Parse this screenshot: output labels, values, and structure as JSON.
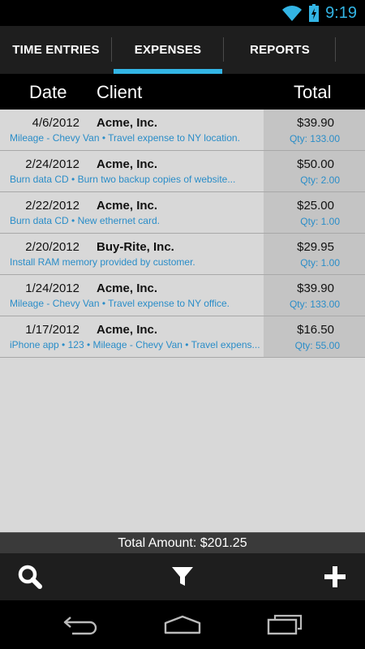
{
  "status_bar": {
    "time": "9:19",
    "wifi_icon": "wifi-icon",
    "battery_icon": "battery-charging-icon",
    "accent": "#33b5e5"
  },
  "tabs": [
    {
      "label": "TIME ENTRIES",
      "active": false
    },
    {
      "label": "EXPENSES",
      "active": true
    },
    {
      "label": "REPORTS",
      "active": false
    }
  ],
  "columns": {
    "date": "Date",
    "client": "Client",
    "total": "Total"
  },
  "expenses": [
    {
      "date": "4/6/2012",
      "client": "Acme, Inc.",
      "description": "Mileage - Chevy Van • Travel expense to NY location.",
      "total": "$39.90",
      "qty": "Qty: 133.00"
    },
    {
      "date": "2/24/2012",
      "client": "Acme, Inc.",
      "description": "Burn data CD • Burn two backup copies of website...",
      "total": "$50.00",
      "qty": "Qty: 2.00"
    },
    {
      "date": "2/22/2012",
      "client": "Acme, Inc.",
      "description": "Burn data CD • New ethernet card.",
      "total": "$25.00",
      "qty": "Qty: 1.00"
    },
    {
      "date": "2/20/2012",
      "client": "Buy-Rite, Inc.",
      "description": "Install RAM memory provided by customer.",
      "total": "$29.95",
      "qty": "Qty: 1.00"
    },
    {
      "date": "1/24/2012",
      "client": "Acme, Inc.",
      "description": "Mileage - Chevy Van • Travel expense to NY office.",
      "total": "$39.90",
      "qty": "Qty: 133.00"
    },
    {
      "date": "1/17/2012",
      "client": "Acme, Inc.",
      "description": "iPhone app • 123 • Mileage - Chevy Van • Travel expens...",
      "total": "$16.50",
      "qty": "Qty: 55.00"
    }
  ],
  "summary": {
    "total_amount": "Total Amount: $201.25"
  },
  "action_bar": {
    "search_icon": "search-icon",
    "filter_icon": "filter-icon",
    "add_icon": "add-icon"
  },
  "nav_bar": {
    "back_icon": "back-icon",
    "home_icon": "home-icon",
    "recent_icon": "recent-apps-icon"
  }
}
